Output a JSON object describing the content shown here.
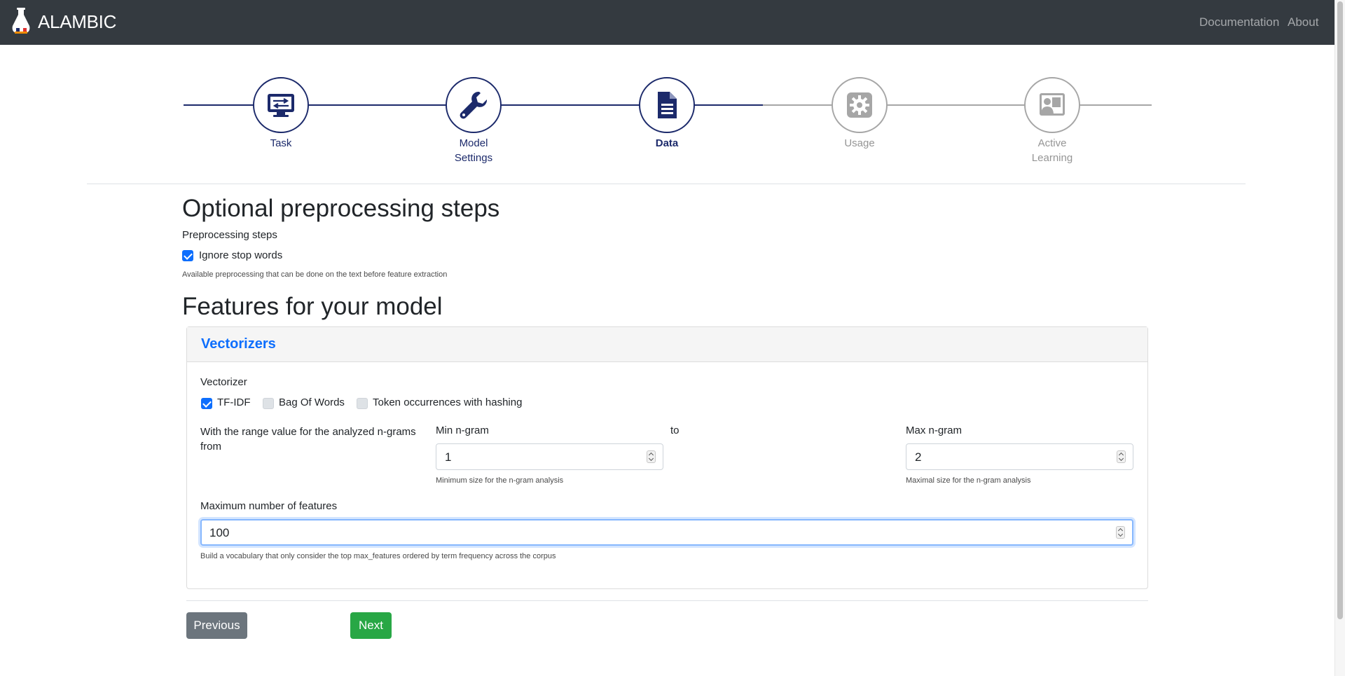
{
  "app": {
    "name": "ALAMBIC"
  },
  "nav": {
    "documentation": "Documentation",
    "about": "About"
  },
  "stepper": {
    "steps": [
      {
        "label_line1": "Task",
        "label_line2": "",
        "state": "done",
        "icon": "monitor-settings-icon"
      },
      {
        "label_line1": "Model",
        "label_line2": "Settings",
        "state": "done",
        "icon": "wrench-icon"
      },
      {
        "label_line1": "Data",
        "label_line2": "",
        "state": "current",
        "icon": "document-icon"
      },
      {
        "label_line1": "Usage",
        "label_line2": "",
        "state": "pending",
        "icon": "gear-icon"
      },
      {
        "label_line1": "Active",
        "label_line2": "Learning",
        "state": "pending",
        "icon": "person-board-icon"
      }
    ]
  },
  "preprocessing": {
    "title": "Optional preprocessing steps",
    "group_label": "Preprocessing steps",
    "options": [
      {
        "label": "Ignore stop words",
        "checked": true
      }
    ],
    "help": "Available preprocessing that can be done on the text before feature extraction"
  },
  "features": {
    "title": "Features for your model",
    "card_title": "Vectorizers",
    "vectorizer_label": "Vectorizer",
    "vectorizers": [
      {
        "label": "TF-IDF",
        "checked": true
      },
      {
        "label": "Bag Of Words",
        "checked": false
      },
      {
        "label": "Token occurrences with hashing",
        "checked": false
      }
    ],
    "ngram_intro_line1": "With the range value for the analyzed n-grams",
    "ngram_intro_line2": "from",
    "min_label": "Min n-gram",
    "min_value": "1",
    "min_help": "Minimum size for the n-gram analysis",
    "to_label": "to",
    "max_label": "Max n-gram",
    "max_value": "2",
    "max_help": "Maximal size for the n-gram analysis",
    "maxfeat_label": "Maximum number of features",
    "maxfeat_value": "100",
    "maxfeat_help": "Build a vocabulary that only consider the top max_features ordered by term frequency across the corpus"
  },
  "buttons": {
    "previous": "Previous",
    "next": "Next"
  },
  "colors": {
    "navbar": "#343a40",
    "stepper_active": "#1c2a6b",
    "stepper_inactive": "#a6a6a6",
    "primary": "#0d6efd",
    "next_button": "#28a745",
    "prev_button": "#6c757d"
  }
}
